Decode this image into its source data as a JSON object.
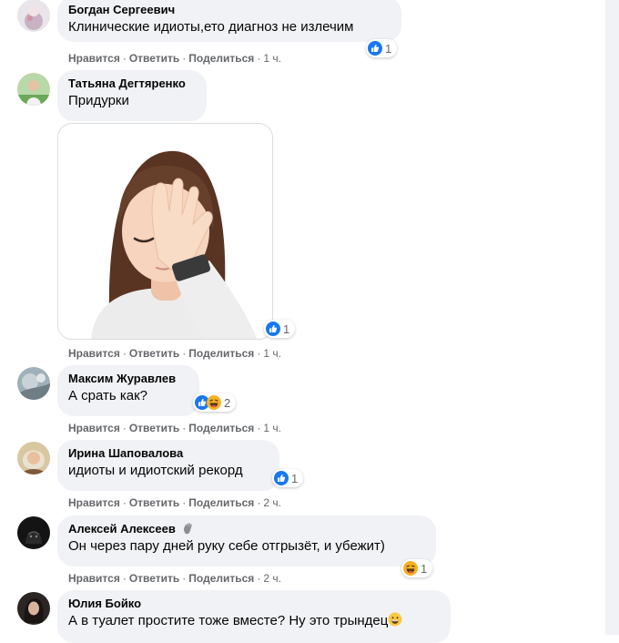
{
  "comments": [
    {
      "author": "Богдан Сергеевич",
      "text": "Клинические идиоты,ето диагноз не излечим",
      "reactions": [
        "like"
      ],
      "reaction_count": "1",
      "time": "1 ч."
    },
    {
      "author": "Татьяна Дегтяренко",
      "text": "Придурки",
      "reactions": [
        "like"
      ],
      "reaction_count": "1",
      "time": "1 ч.",
      "attachment": "facepalm-sticker"
    },
    {
      "author": "Максим Журавлев",
      "text": "А срать как?",
      "reactions": [
        "like",
        "haha"
      ],
      "reaction_count": "2",
      "time": "1 ч."
    },
    {
      "author": "Ирина Шаповалова",
      "text": "идиоты и идиотский рекорд",
      "reactions": [
        "like"
      ],
      "reaction_count": "1",
      "time": "2 ч."
    },
    {
      "author": "Алексей Алексеев",
      "text": "Он через пару дней руку себе отгрызёт, и убежит)",
      "reactions": [
        "haha"
      ],
      "reaction_count": "1",
      "time": "2 ч.",
      "author_badge": "waving-hand-icon"
    },
    {
      "author": "Юлия Бойко",
      "text": "А в туалет простите тоже вместе? Ну это трындец",
      "text_emoji": "grinning-face-icon"
    }
  ],
  "actions": {
    "like": "Нравится",
    "reply": "Ответить",
    "share": "Поделиться",
    "separator": "·"
  },
  "colors": {
    "bubble": "#f0f2f5",
    "like_blue": "#1877f2",
    "haha_yellow": "#f7b125",
    "meta_gray": "#65676b"
  }
}
